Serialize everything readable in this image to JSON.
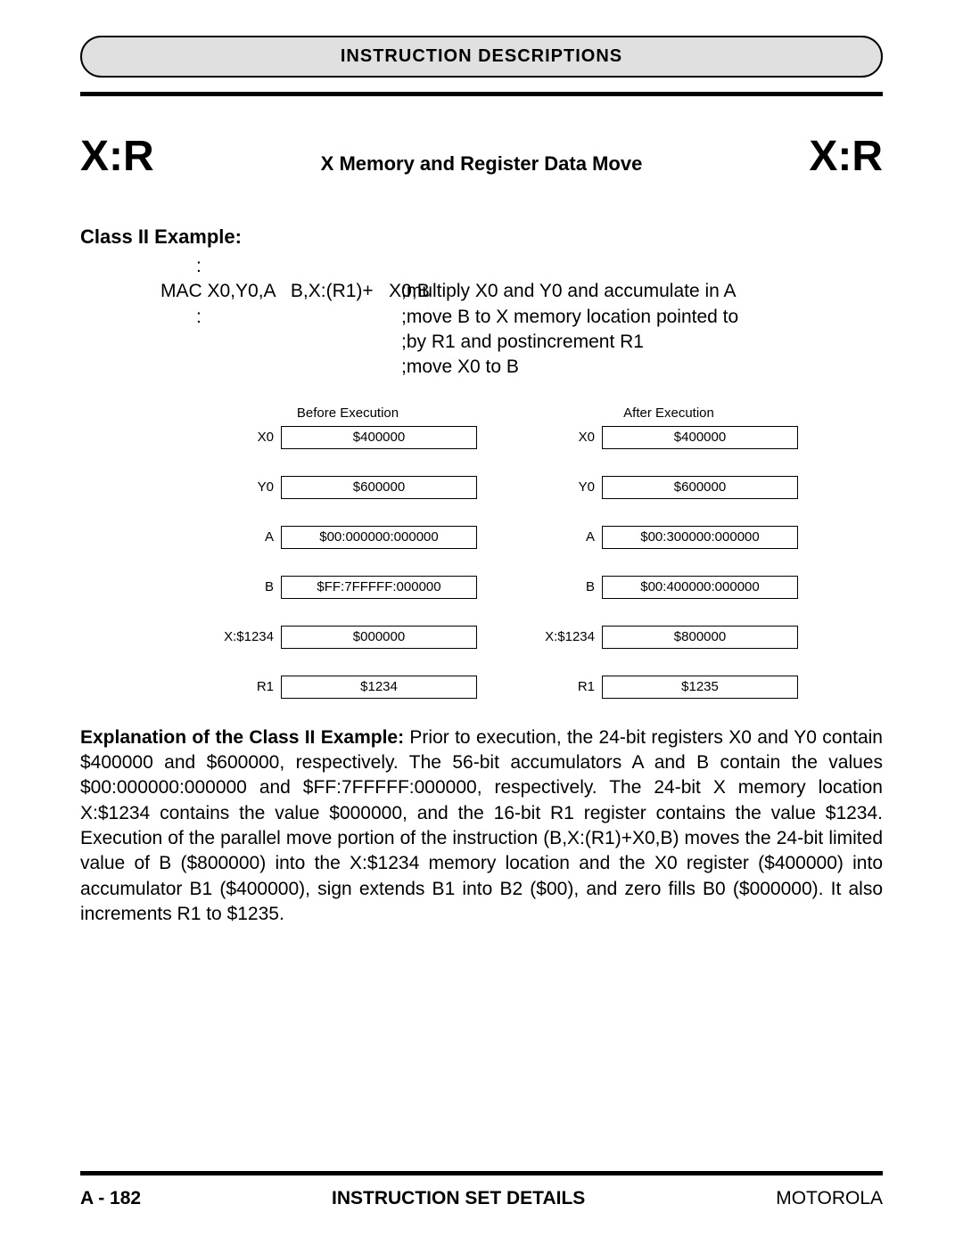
{
  "header": {
    "title": "INSTRUCTION DESCRIPTIONS"
  },
  "title_row": {
    "mnemonic_left": "X:R",
    "subtitle": "X Memory and Register Data Move",
    "mnemonic_right": "X:R"
  },
  "example": {
    "label": "Class II Example:",
    "rows": [
      {
        "left": ":",
        "right": "",
        "colon": true
      },
      {
        "left": "MAC X0,Y0,A   B,X:(R1)+   X0,B",
        "right": ";multiply X0 and Y0 and accumulate in A"
      },
      {
        "left": ":",
        "right": ";move B to X memory location pointed to",
        "colon": true
      },
      {
        "left": "",
        "right": ";by R1 and postincrement R1"
      },
      {
        "left": "",
        "right": ";move X0 to B"
      }
    ]
  },
  "tables": {
    "before": {
      "title": "Before Execution",
      "rows": [
        {
          "label": "X0",
          "value": "$400000"
        },
        {
          "label": "Y0",
          "value": "$600000"
        },
        {
          "label": "A",
          "value": "$00:000000:000000"
        },
        {
          "label": "B",
          "value": "$FF:7FFFFF:000000"
        },
        {
          "label": "X:$1234",
          "value": "$000000"
        },
        {
          "label": "R1",
          "value": "$1234"
        }
      ]
    },
    "after": {
      "title": "After Execution",
      "rows": [
        {
          "label": "X0",
          "value": "$400000"
        },
        {
          "label": "Y0",
          "value": "$600000"
        },
        {
          "label": "A",
          "value": "$00:300000:000000"
        },
        {
          "label": "B",
          "value": "$00:400000:000000"
        },
        {
          "label": "X:$1234",
          "value": "$800000"
        },
        {
          "label": "R1",
          "value": "$1235"
        }
      ]
    }
  },
  "explanation": {
    "lead": "Explanation of the Class II Example: ",
    "body": "Prior to execution, the 24-bit registers X0 and Y0 contain $400000 and $600000, respectively. The 56-bit accumulators A and B contain the values $00:000000:000000 and $FF:7FFFFF:000000, respectively. The 24-bit X memory location X:$1234 contains the value $000000, and the 16-bit R1 register contains the value $1234. Execution of the parallel move portion of the instruction (B,X:(R1)+X0,B) moves the 24-bit limited value of B ($800000) into the X:$1234 memory location and the X0 register ($400000) into accumulator B1 ($400000), sign extends B1 into B2 ($00), and zero fills B0 ($000000). It also increments R1 to $1235."
  },
  "footer": {
    "left": "A - 182",
    "center": "INSTRUCTION SET DETAILS",
    "right": "MOTOROLA"
  }
}
